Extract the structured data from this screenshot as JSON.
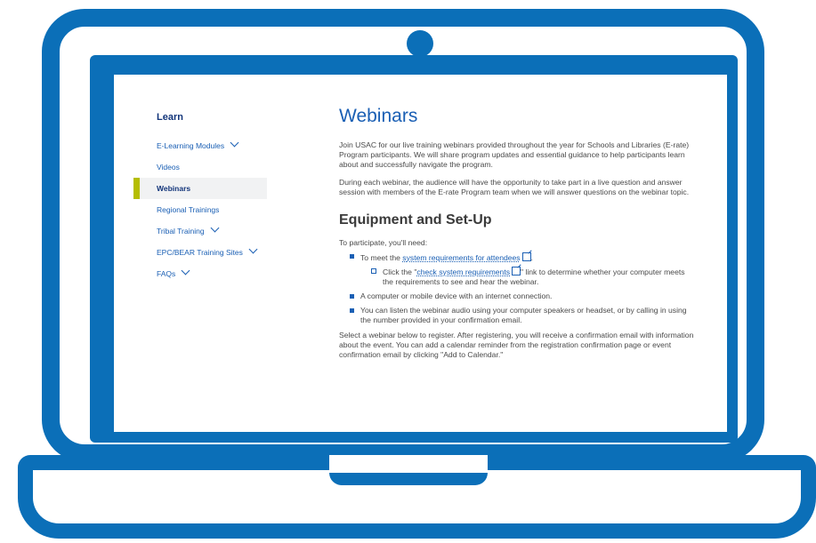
{
  "sidebar": {
    "heading": "Learn",
    "items": [
      {
        "label": "E-Learning Modules",
        "expandable": true,
        "active": false
      },
      {
        "label": "Videos",
        "expandable": false,
        "active": false
      },
      {
        "label": "Webinars",
        "expandable": false,
        "active": true
      },
      {
        "label": "Regional Trainings",
        "expandable": false,
        "active": false
      },
      {
        "label": "Tribal Training",
        "expandable": true,
        "active": false
      },
      {
        "label": "EPC/BEAR Training Sites",
        "expandable": true,
        "active": false
      },
      {
        "label": "FAQs",
        "expandable": true,
        "active": false
      }
    ]
  },
  "main": {
    "title": "Webinars",
    "intro_1": "Join USAC for our live training webinars provided throughout the year for Schools and Libraries (E-rate) Program participants. We will share program updates and essential guidance to help participants learn about and successfully navigate the program.",
    "intro_2": "During each webinar, the audience will have the opportunity to take part in a live question and answer session with members of the E-rate Program team when we will answer questions on the webinar topic.",
    "section_title": "Equipment and Set-Up",
    "lead": "To participate, you'll need:",
    "bullet_1_pre": "To meet the ",
    "bullet_1_link": "system requirements for attendees",
    "bullet_1_post": ".",
    "sub_1_pre": "Click the \"",
    "sub_1_link": "check system requirements",
    "sub_1_post": "\" link to determine whether your computer meets the requirements to see and hear the webinar.",
    "bullet_2": "A computer or mobile device with an internet connection.",
    "bullet_3": "You can listen the webinar audio using your computer speakers or headset, or by calling in using the number provided in your confirmation email.",
    "outro": "Select a webinar below to register. After registering, you will receive a confirmation email with information about the event. You can add a calendar reminder from the registration confirmation page or event confirmation email by clicking \"Add to Calendar.\""
  },
  "colors": {
    "laptop_frame": "#0b6fb8",
    "link": "#1a5fb4",
    "heading_dark": "#12357a",
    "active_marker": "#b5bd00"
  }
}
